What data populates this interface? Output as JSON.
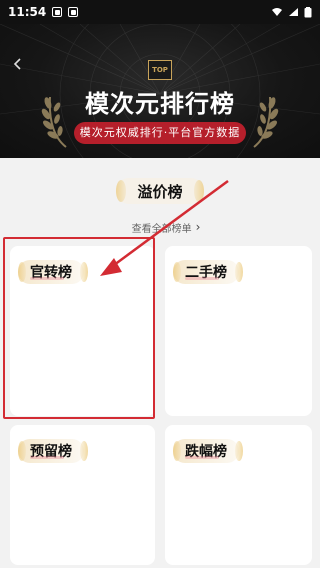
{
  "status_bar": {
    "time": "11:54"
  },
  "header": {
    "badge": "TOP",
    "title": "模次元排行榜",
    "subtitle": "模次元权威排行·平台官方数据"
  },
  "section": {
    "title": "溢价榜",
    "view_all": "查看全部榜单"
  },
  "cards": [
    {
      "title": "官转榜"
    },
    {
      "title": "二手榜"
    },
    {
      "title": "预留榜"
    },
    {
      "title": "跌幅榜"
    }
  ],
  "colors": {
    "accent_red": "#d32b33",
    "banner_pill": "#b51f2b",
    "gold": "#c8a35a",
    "background": "#f2f2f2"
  },
  "icons": {
    "back": "back-arrow-icon",
    "wifi": "wifi-icon",
    "signal": "signal-icon",
    "battery": "battery-icon",
    "chevron": "chevron-right-icon"
  }
}
